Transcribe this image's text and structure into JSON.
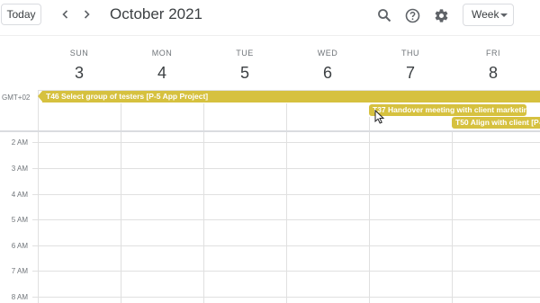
{
  "header": {
    "today_label": "Today",
    "month_title": "October 2021",
    "view_label": "Week",
    "icons": [
      "chevron-left-icon",
      "chevron-right-icon",
      "search-icon",
      "help-icon",
      "gear-icon",
      "caret-down-icon"
    ]
  },
  "days": [
    {
      "name": "SUN",
      "number": "3"
    },
    {
      "name": "MON",
      "number": "4"
    },
    {
      "name": "TUE",
      "number": "5"
    },
    {
      "name": "WED",
      "number": "6"
    },
    {
      "name": "THU",
      "number": "7"
    },
    {
      "name": "FRI",
      "number": "8"
    }
  ],
  "timezone_label": "GMT+02",
  "time_labels": [
    "2 AM",
    "3 AM",
    "4 AM",
    "5 AM",
    "6 AM",
    "7 AM",
    "8 AM"
  ],
  "events": {
    "t46": "T46 Select group of testers [P-5 App Project]",
    "t37": "T37 Handover meeting with client marketing",
    "t50": "T50 Align with client [P-5"
  },
  "colors": {
    "event": "#d6c13f",
    "gridline": "#e0e0e0",
    "text": "#3c4043",
    "muted_text": "#70757a"
  }
}
